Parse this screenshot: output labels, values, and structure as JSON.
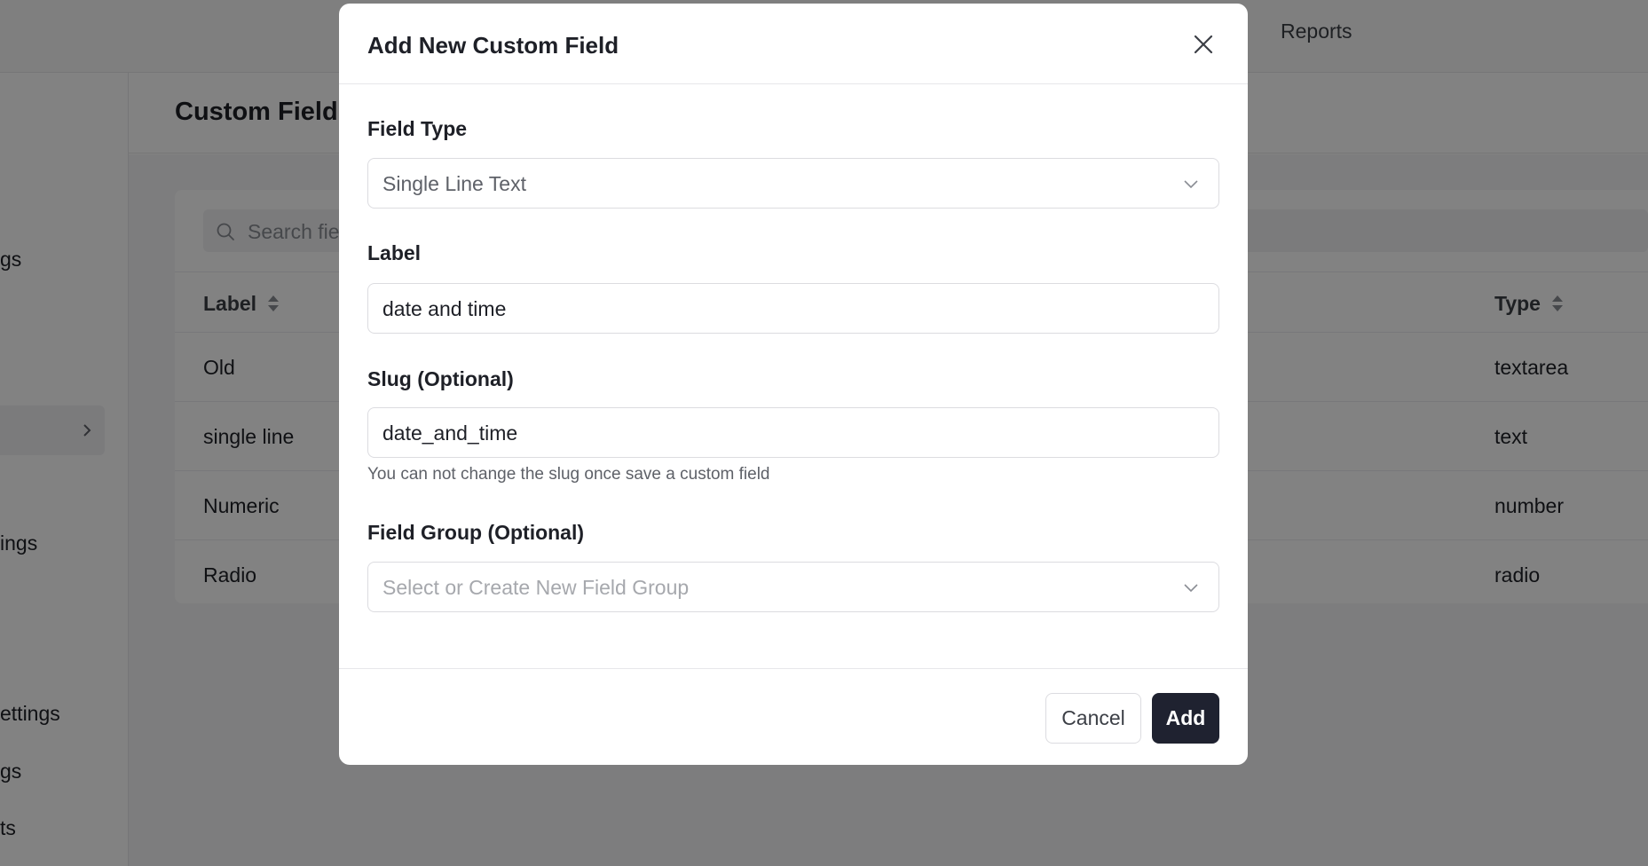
{
  "background": {
    "topnav": {
      "reports_label": "Reports"
    },
    "sidebar": {
      "items": [
        {
          "label": "gs"
        },
        {
          "label": ""
        },
        {
          "label": "ings"
        },
        {
          "label": "ettings"
        },
        {
          "label": "gs"
        },
        {
          "label": "ts"
        }
      ]
    },
    "page_title": "Custom Field",
    "search": {
      "placeholder": "Search fie"
    },
    "table": {
      "columns": {
        "label": "Label",
        "type": "Type"
      },
      "rows": [
        {
          "label": "Old",
          "type": "textarea"
        },
        {
          "label": "single line",
          "type": "text"
        },
        {
          "label": "Numeric",
          "type": "number"
        },
        {
          "label": "Radio",
          "type": "radio"
        }
      ]
    }
  },
  "modal": {
    "title": "Add New Custom Field",
    "field_type": {
      "label": "Field Type",
      "value": "Single Line Text"
    },
    "label_field": {
      "label": "Label",
      "value": "date and time"
    },
    "slug_field": {
      "label": "Slug (Optional)",
      "value": "date_and_time",
      "help": "You can not change the slug once save a custom field"
    },
    "field_group": {
      "label": "Field Group (Optional)",
      "placeholder": "Select or Create New Field Group"
    },
    "footer": {
      "cancel_label": "Cancel",
      "add_label": "Add"
    }
  },
  "colors": {
    "primary_button": "#1f2230",
    "overlay": "rgba(0,0,0,0.49)"
  },
  "icons": [
    "close-icon",
    "chevron-down-icon",
    "search-icon",
    "sort-icon",
    "chevron-right-icon"
  ]
}
